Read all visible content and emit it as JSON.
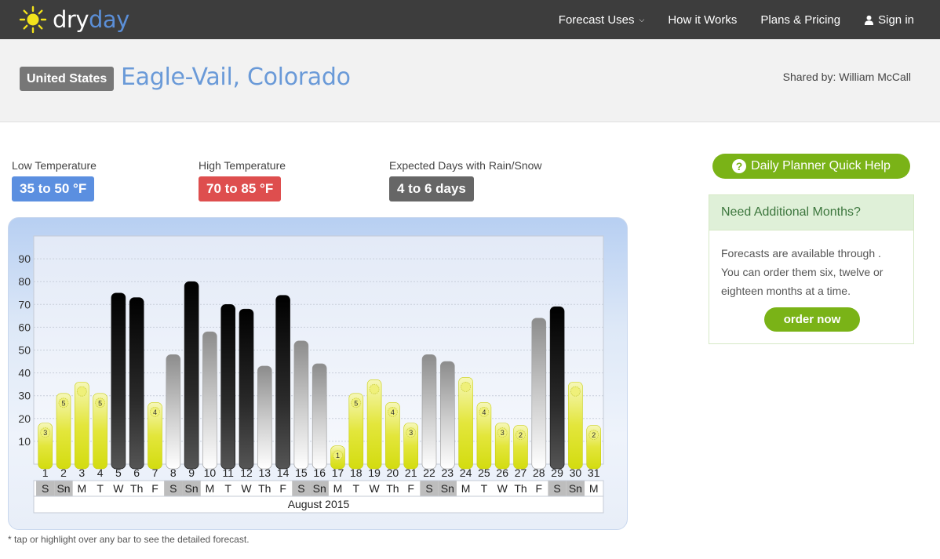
{
  "brand": {
    "dry": "dry",
    "day": "day",
    "icon": "sun-icon",
    "accent": "#5b8fd8"
  },
  "nav": {
    "forecast_uses": "Forecast Uses",
    "how_it_works": "How it Works",
    "plans_pricing": "Plans & Pricing",
    "sign_in": "Sign in"
  },
  "location": {
    "country": "United States",
    "city": "Eagle-Vail, Colorado",
    "shared_by": "Shared by: William McCall"
  },
  "stats": {
    "low_label": "Low Temperature",
    "low_value": "35 to 50 °F",
    "high_label": "High Temperature",
    "high_value": "70 to 85 °F",
    "rain_label": "Expected Days with Rain/Snow",
    "rain_value": "4 to 6 days"
  },
  "footnote": "* tap or highlight over any bar to see the detailed forecast.",
  "help_button": "Daily Planner Quick Help",
  "panel": {
    "title": "Need Additional Months?",
    "body": "Forecasts are available through . You can order them six, twelve or eighteen months at a time.",
    "order_button": "order now"
  },
  "colors": {
    "sunny": "#dde21a",
    "rain": "#151515",
    "cloudy": "#9a9a9a",
    "green": "#7ab317",
    "weekend": "#bdbdbd"
  },
  "chart_data": {
    "type": "bar",
    "month_label": "August 2015",
    "y_ticks": [
      10,
      20,
      30,
      40,
      50,
      60,
      70,
      80,
      90
    ],
    "ylim": [
      0,
      100
    ],
    "days": [
      {
        "d": "1",
        "w": "S",
        "v": 18,
        "k": "sunny",
        "n": "3"
      },
      {
        "d": "2",
        "w": "Sn",
        "v": 31,
        "k": "sunny",
        "n": "5"
      },
      {
        "d": "3",
        "w": "M",
        "v": 36,
        "k": "sunny",
        "n": ""
      },
      {
        "d": "4",
        "w": "T",
        "v": 31,
        "k": "sunny",
        "n": "5"
      },
      {
        "d": "5",
        "w": "W",
        "v": 75,
        "k": "rain",
        "n": ""
      },
      {
        "d": "6",
        "w": "Th",
        "v": 73,
        "k": "rain",
        "n": ""
      },
      {
        "d": "7",
        "w": "F",
        "v": 27,
        "k": "sunny",
        "n": "4"
      },
      {
        "d": "8",
        "w": "S",
        "v": 48,
        "k": "cloudy",
        "n": ""
      },
      {
        "d": "9",
        "w": "Sn",
        "v": 80,
        "k": "rain",
        "n": ""
      },
      {
        "d": "10",
        "w": "M",
        "v": 58,
        "k": "cloudy",
        "n": ""
      },
      {
        "d": "11",
        "w": "T",
        "v": 70,
        "k": "rain",
        "n": ""
      },
      {
        "d": "12",
        "w": "W",
        "v": 68,
        "k": "rain",
        "n": ""
      },
      {
        "d": "13",
        "w": "Th",
        "v": 43,
        "k": "cloudy",
        "n": ""
      },
      {
        "d": "14",
        "w": "F",
        "v": 74,
        "k": "rain",
        "n": ""
      },
      {
        "d": "15",
        "w": "S",
        "v": 54,
        "k": "cloudy",
        "n": ""
      },
      {
        "d": "16",
        "w": "Sn",
        "v": 44,
        "k": "cloudy",
        "n": ""
      },
      {
        "d": "17",
        "w": "M",
        "v": 8,
        "k": "sunny",
        "n": "1"
      },
      {
        "d": "18",
        "w": "T",
        "v": 31,
        "k": "sunny",
        "n": "5"
      },
      {
        "d": "19",
        "w": "W",
        "v": 37,
        "k": "sunny",
        "n": ""
      },
      {
        "d": "20",
        "w": "Th",
        "v": 27,
        "k": "sunny",
        "n": "4"
      },
      {
        "d": "21",
        "w": "F",
        "v": 18,
        "k": "sunny",
        "n": "3"
      },
      {
        "d": "22",
        "w": "S",
        "v": 48,
        "k": "cloudy",
        "n": ""
      },
      {
        "d": "23",
        "w": "Sn",
        "v": 45,
        "k": "cloudy",
        "n": ""
      },
      {
        "d": "24",
        "w": "M",
        "v": 38,
        "k": "sunny",
        "n": ""
      },
      {
        "d": "25",
        "w": "T",
        "v": 27,
        "k": "sunny",
        "n": "4"
      },
      {
        "d": "26",
        "w": "W",
        "v": 18,
        "k": "sunny",
        "n": "3"
      },
      {
        "d": "27",
        "w": "Th",
        "v": 17,
        "k": "sunny",
        "n": "2"
      },
      {
        "d": "28",
        "w": "F",
        "v": 64,
        "k": "cloudy",
        "n": ""
      },
      {
        "d": "29",
        "w": "S",
        "v": 69,
        "k": "rain",
        "n": ""
      },
      {
        "d": "30",
        "w": "Sn",
        "v": 36,
        "k": "sunny",
        "n": ""
      },
      {
        "d": "31",
        "w": "M",
        "v": 17,
        "k": "sunny",
        "n": "2"
      }
    ]
  }
}
